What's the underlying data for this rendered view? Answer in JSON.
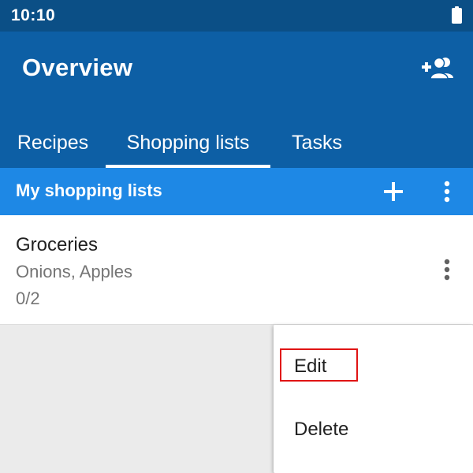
{
  "status_bar": {
    "time": "10:10",
    "battery_icon": "battery-full-icon"
  },
  "app_bar": {
    "title": "Overview",
    "action_icon": "add-person-icon",
    "background_color": "#0d5fa5",
    "status_color": "#0b4f86"
  },
  "tabs": [
    {
      "label": "Recipes",
      "selected": false
    },
    {
      "label": "Shopping lists",
      "selected": true
    },
    {
      "label": "Tasks",
      "selected": false
    }
  ],
  "sub_header": {
    "title": "My shopping lists",
    "add_icon": "plus-icon",
    "more_icon": "more-vert-icon",
    "background_color": "#1e88e5"
  },
  "shopping_lists": [
    {
      "name": "Groceries",
      "items": "Onions, Apples",
      "progress": "0/2",
      "more_icon": "more-vert-icon"
    }
  ],
  "context_menu": {
    "items": [
      {
        "label": "Edit",
        "highlighted": true
      },
      {
        "label": "Delete",
        "highlighted": false
      }
    ],
    "highlight_color": "#e01414"
  }
}
